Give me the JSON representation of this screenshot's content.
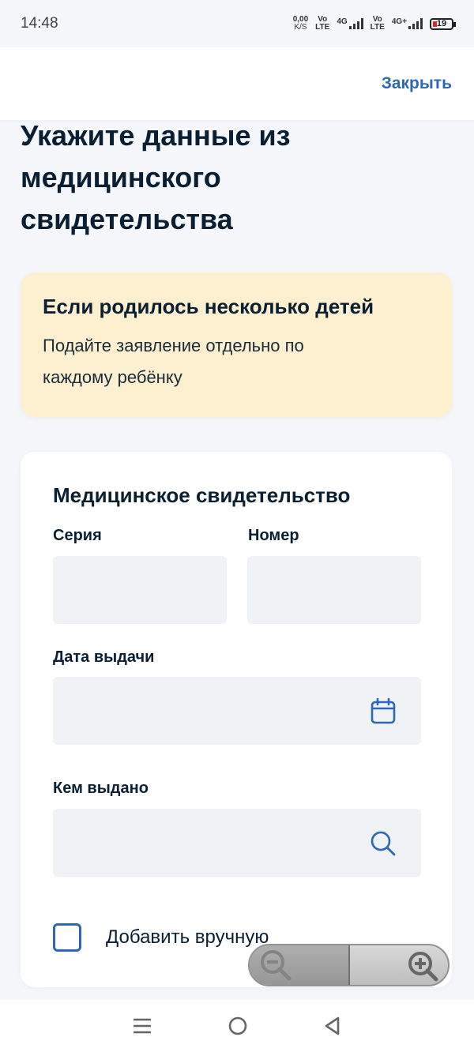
{
  "status_bar": {
    "time": "14:48",
    "net_speed_value": "0,00",
    "net_speed_unit": "K/S",
    "sim1_top": "Vo",
    "sim1_bottom": "LTE",
    "sim1_network": "4G",
    "sim2_top": "Vo",
    "sim2_bottom": "LTE",
    "sim2_network": "4G+",
    "battery_level": "19"
  },
  "header": {
    "close_label": "Закрыть"
  },
  "page": {
    "title": "Укажите данные из медицинского свидетельства"
  },
  "notice": {
    "title": "Если родилось несколько детей",
    "text": "Подайте заявление отдельно по каждому ребёнку"
  },
  "form": {
    "title": "Медицинское свидетельство",
    "series_label": "Серия",
    "number_label": "Номер",
    "issue_date_label": "Дата выдачи",
    "issued_by_label": "Кем выдано",
    "manual_checkbox_label": "Добавить вручную",
    "manual_checked": false
  },
  "icons": {
    "calendar": "calendar-icon",
    "search": "search-icon",
    "zoom_out": "zoom-out-icon",
    "zoom_in": "zoom-in-icon",
    "nav_menu": "menu-icon",
    "nav_home": "home-icon",
    "nav_back": "back-icon"
  },
  "colors": {
    "accent": "#2d67b8",
    "background": "#f5f7fb",
    "notice_bg": "#fdf0d1",
    "field_bg": "#f0f2f6",
    "text": "#0b1f33"
  }
}
